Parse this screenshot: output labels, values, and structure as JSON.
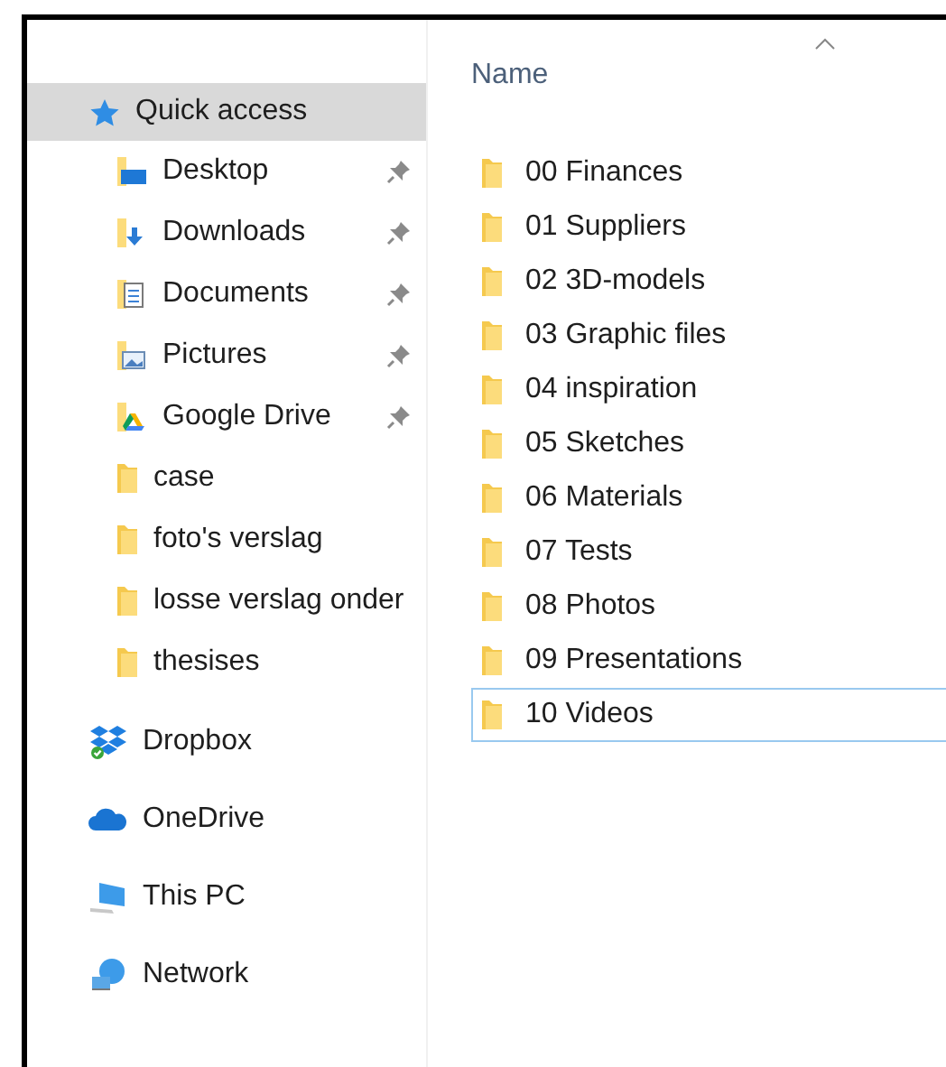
{
  "navigation": [
    {
      "label": "Quick access",
      "kind": "star",
      "selected": true,
      "children": [
        {
          "label": "Desktop",
          "kind": "desktop",
          "pinned": true
        },
        {
          "label": "Downloads",
          "kind": "downloads",
          "pinned": true
        },
        {
          "label": "Documents",
          "kind": "documents",
          "pinned": true
        },
        {
          "label": "Pictures",
          "kind": "pictures",
          "pinned": true
        },
        {
          "label": "Google Drive",
          "kind": "drive",
          "pinned": true
        },
        {
          "label": "case",
          "kind": "folder",
          "pinned": false
        },
        {
          "label": "foto's verslag",
          "kind": "folder",
          "pinned": false
        },
        {
          "label": "losse verslag onder",
          "kind": "folder",
          "pinned": false
        },
        {
          "label": "thesises",
          "kind": "folder",
          "pinned": false
        }
      ]
    },
    {
      "label": "Dropbox",
      "kind": "dropbox",
      "selected": false
    },
    {
      "label": "OneDrive",
      "kind": "onedrive",
      "selected": false
    },
    {
      "label": "This PC",
      "kind": "pc",
      "selected": false
    },
    {
      "label": "Network",
      "kind": "network",
      "selected": false
    }
  ],
  "file_list": {
    "column": "Name",
    "files": [
      {
        "name": "00 Finances",
        "focused": false
      },
      {
        "name": "01 Suppliers",
        "focused": false
      },
      {
        "name": "02 3D-models",
        "focused": false
      },
      {
        "name": "03 Graphic files",
        "focused": false
      },
      {
        "name": "04 inspiration",
        "focused": false
      },
      {
        "name": "05 Sketches",
        "focused": false
      },
      {
        "name": "06 Materials",
        "focused": false
      },
      {
        "name": "07 Tests",
        "focused": false
      },
      {
        "name": "08 Photos",
        "focused": false
      },
      {
        "name": "09 Presentations",
        "focused": false
      },
      {
        "name": "10 Videos",
        "focused": true
      }
    ]
  }
}
